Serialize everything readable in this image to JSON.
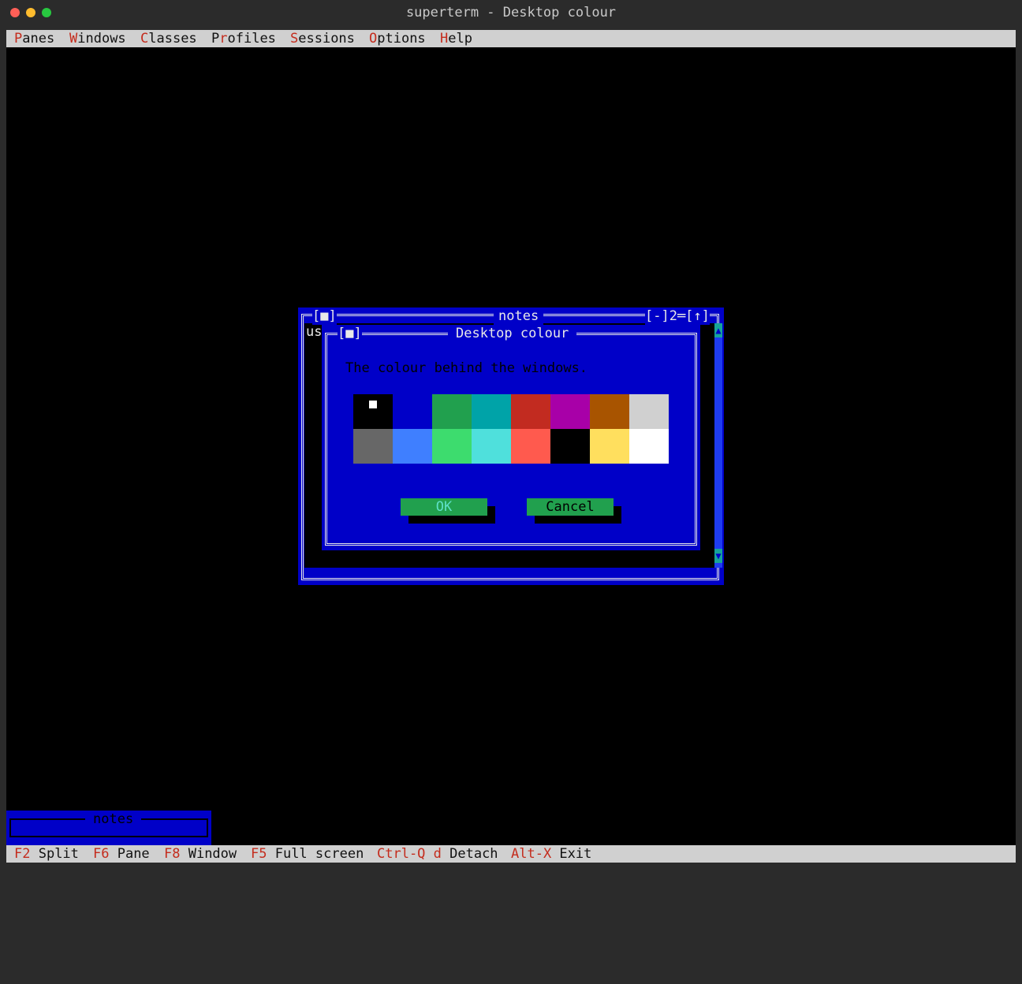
{
  "window": {
    "title": "superterm - Desktop colour"
  },
  "menu": [
    {
      "hot": "P",
      "rest": "anes"
    },
    {
      "hot": "W",
      "rest": "indows"
    },
    {
      "hot": "C",
      "rest": "lasses"
    },
    {
      "hot": "P",
      "pre": "",
      "rest": "rofiles",
      "alt": "Pr"
    },
    {
      "hot": "S",
      "rest": "essions"
    },
    {
      "hot": "O",
      "rest": "ptions"
    },
    {
      "hot": "H",
      "rest": "elp"
    }
  ],
  "profiles_menu": {
    "pre": "P",
    "hot": "r",
    "rest": "ofiles"
  },
  "status": [
    {
      "key": "F2",
      "label": " Split"
    },
    {
      "key": "F6",
      "label": " Pane"
    },
    {
      "key": "F8",
      "label": " Window"
    },
    {
      "key": "F5",
      "label": " Full screen"
    },
    {
      "key": "Ctrl-Q d",
      "label": " Detach"
    },
    {
      "key": "Alt-X",
      "label": " Exit"
    }
  ],
  "notes_window": {
    "title": "notes",
    "close_glyph": "[■]",
    "controls": "[-]2═[↑]",
    "content_peek": "us",
    "scroll_up": "▲",
    "scroll_down": "▼"
  },
  "minimized": {
    "title": "notes"
  },
  "dialog": {
    "title": "Desktop colour",
    "close_glyph": "[■]",
    "message": "The colour behind the windows.",
    "ok_label": "OK",
    "cancel_label": "Cancel",
    "selected_index": 0,
    "palette": [
      "#000000",
      "#0000c8",
      "#21a04e",
      "#00a3a8",
      "#c22b20",
      "#a800a8",
      "#a85400",
      "#d0d0d0",
      "#676767",
      "#3f7fff",
      "#3ddc6e",
      "#4fe0dc",
      "#ff5a4e",
      "#000000",
      "#ffdf5e",
      "#ffffff"
    ]
  }
}
